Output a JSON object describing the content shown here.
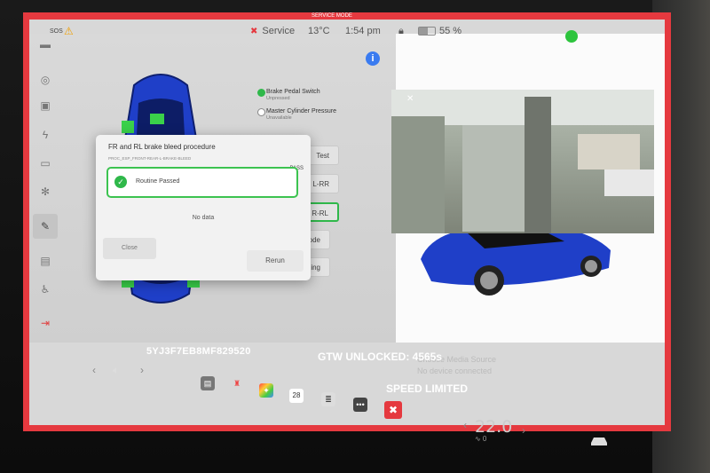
{
  "status_bar": {
    "sos": "SOS",
    "service_label": "Service",
    "temperature": "13°C",
    "time": "1:54 pm",
    "battery_percent": "55 %",
    "battery_level": 0.55,
    "service_mode_tag": "SERVICE MODE"
  },
  "options": [
    {
      "label": "Brake Pedal Switch",
      "sub": "Unpressed",
      "active": true
    },
    {
      "label": "Master Cylinder Pressure",
      "sub": "Unavailable",
      "active": false
    }
  ],
  "test_buttons": [
    "Test",
    "L-RR",
    "R-RL",
    "Mode",
    "ishing"
  ],
  "dialog": {
    "title": "FR and RL brake bleed procedure",
    "id": "PROC_ESP_FRONT-REAR-L-BRAKE-BLEED",
    "pass_badge": "PASS",
    "result": "Routine Passed",
    "no_data": "No data",
    "close": "Close",
    "rerun": "Rerun"
  },
  "media": {
    "source": "Choose Media Source",
    "device": "No device connected"
  },
  "vin_bar": {
    "vin": "5YJ3F7EB8MF829520",
    "gtw": "GTW UNLOCKED: 4565s",
    "speed": "SPEED LIMITED"
  },
  "climate": {
    "temp": "22.0",
    "sub": "∿ 0"
  },
  "calendar_day": "28",
  "colors": {
    "service_red": "#e5393f",
    "pass_green": "#2fb84a",
    "car_blue": "#1f3fc8",
    "info_blue": "#3a7bf0"
  }
}
